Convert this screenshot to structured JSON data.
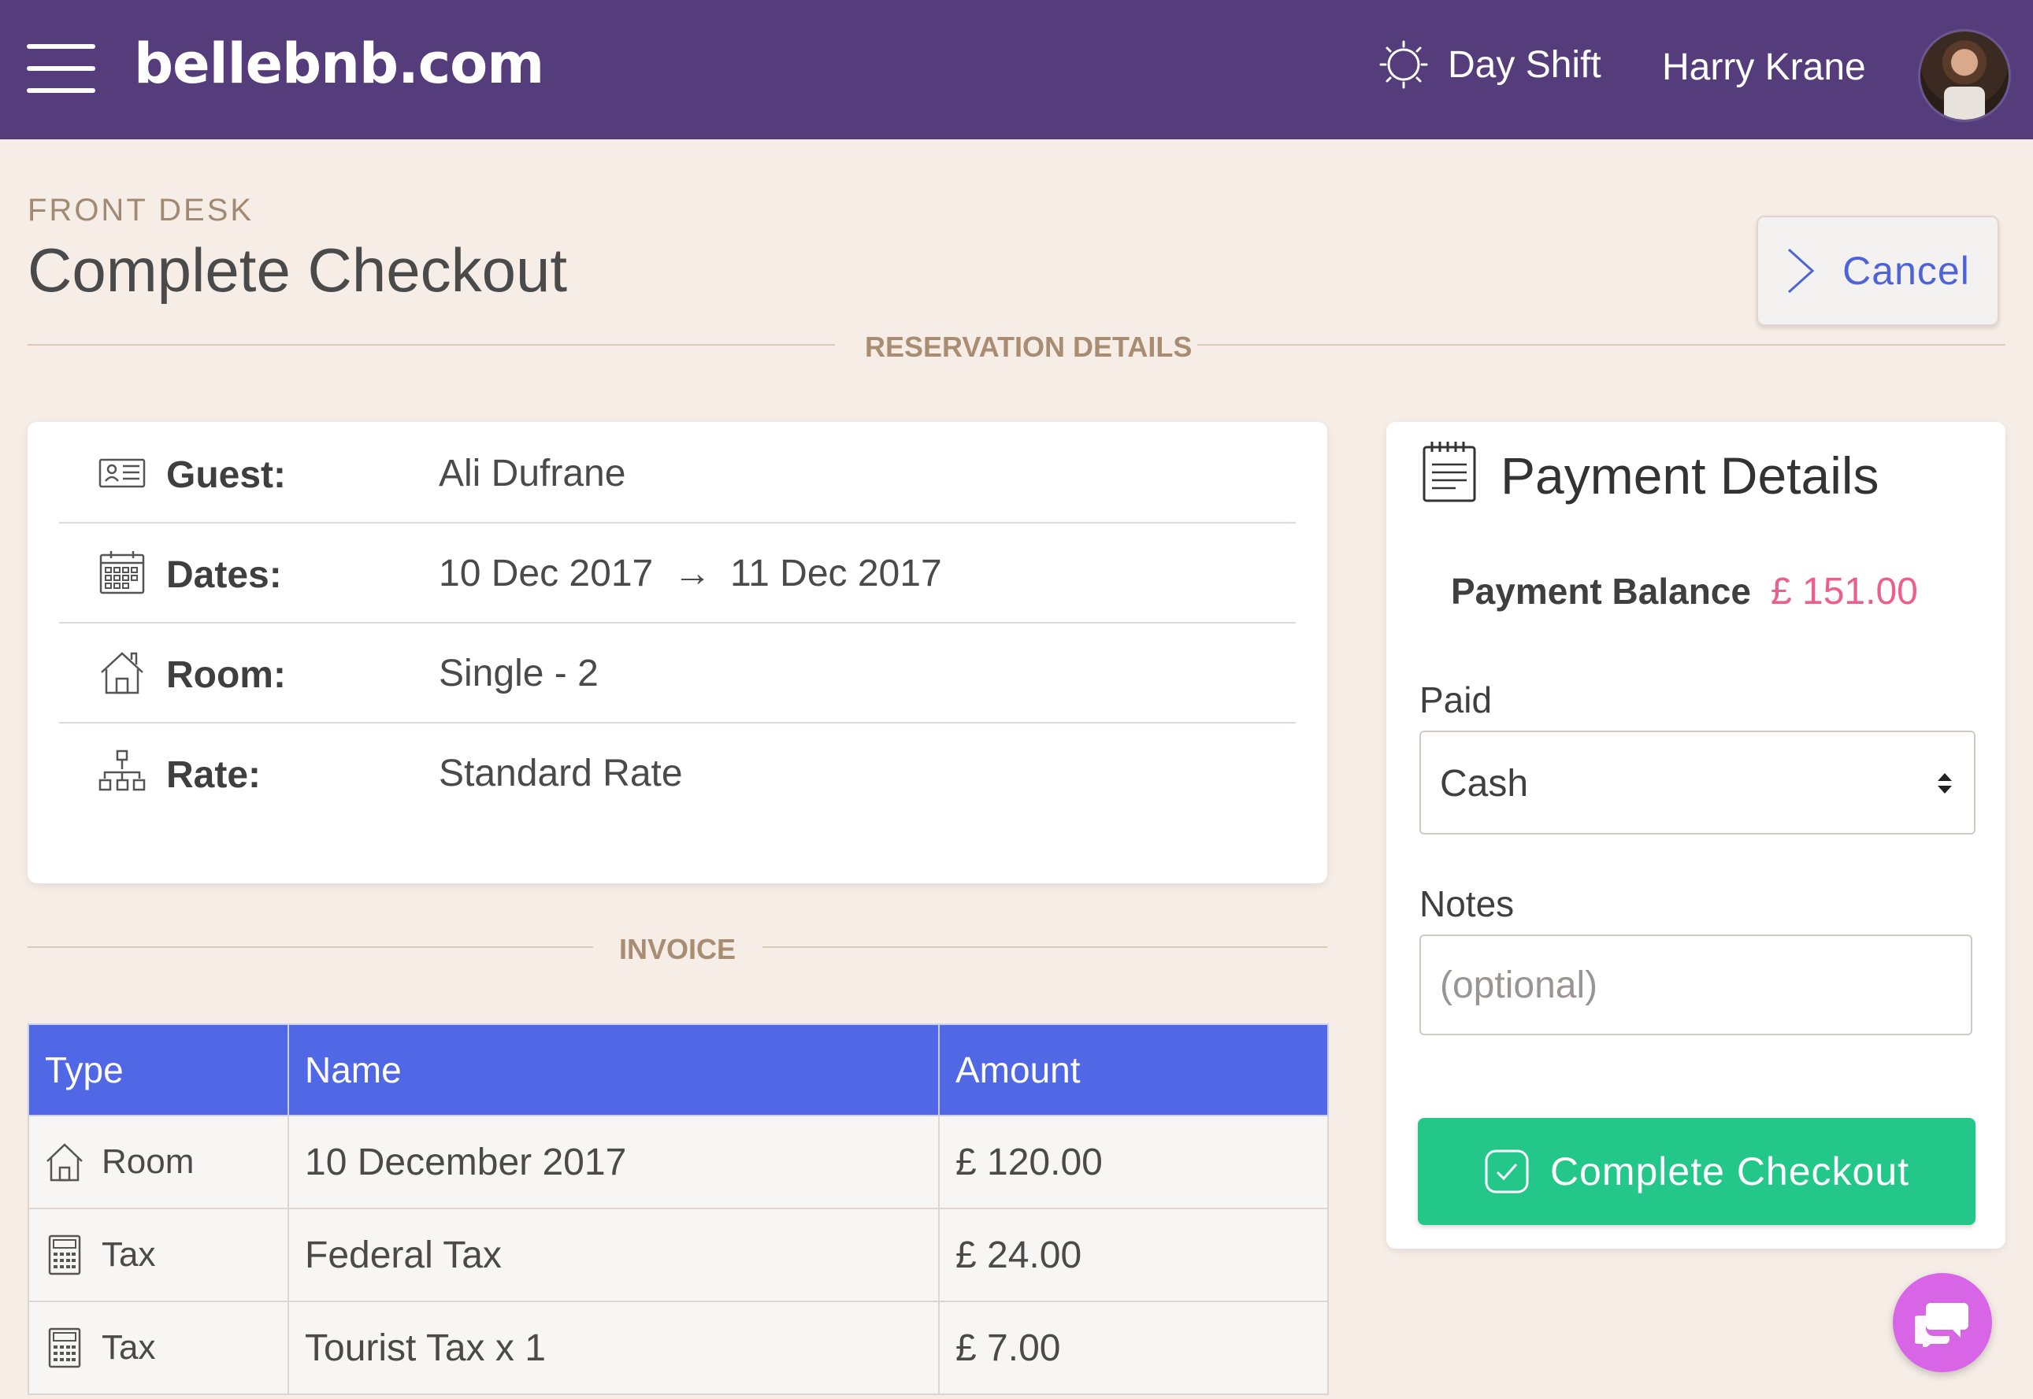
{
  "header": {
    "brand": "bellebnb.com",
    "shift_label": "Day Shift",
    "user_name": "Harry Krane"
  },
  "page": {
    "eyebrow": "FRONT DESK",
    "title": "Complete Checkout",
    "cancel_label": "Cancel"
  },
  "sections": {
    "reservation": "RESERVATION DETAILS",
    "invoice": "INVOICE"
  },
  "reservation": {
    "guest_label": "Guest:",
    "guest_value": "Ali Dufrane",
    "dates_label": "Dates:",
    "date_from": "10 Dec 2017",
    "date_arrow": "→",
    "date_to": "11 Dec 2017",
    "room_label": "Room:",
    "room_value": "Single - 2",
    "rate_label": "Rate:",
    "rate_value": "Standard Rate"
  },
  "invoice": {
    "columns": [
      "Type",
      "Name",
      "Amount"
    ],
    "rows": [
      {
        "type": "Room",
        "type_icon": "home-icon",
        "name": "10 December 2017",
        "amount": "£ 120.00"
      },
      {
        "type": "Tax",
        "type_icon": "calculator-icon",
        "name": "Federal Tax",
        "amount": "£ 24.00"
      },
      {
        "type": "Tax",
        "type_icon": "calculator-icon",
        "name": "Tourist Tax x 1",
        "amount": "£ 7.00"
      }
    ]
  },
  "payment": {
    "title": "Payment Details",
    "balance_label": "Payment Balance",
    "balance_value": "£ 151.00",
    "paid_label": "Paid",
    "paid_value": "Cash",
    "notes_label": "Notes",
    "notes_placeholder": "(optional)",
    "submit_label": "Complete Checkout"
  },
  "colors": {
    "topbar": "#553d7b",
    "background": "#f6ede6",
    "table_header": "#5168e6",
    "balance": "#ec5f8b",
    "submit": "#24c78a",
    "chat": "#d765e6",
    "link": "#4e63d8"
  }
}
